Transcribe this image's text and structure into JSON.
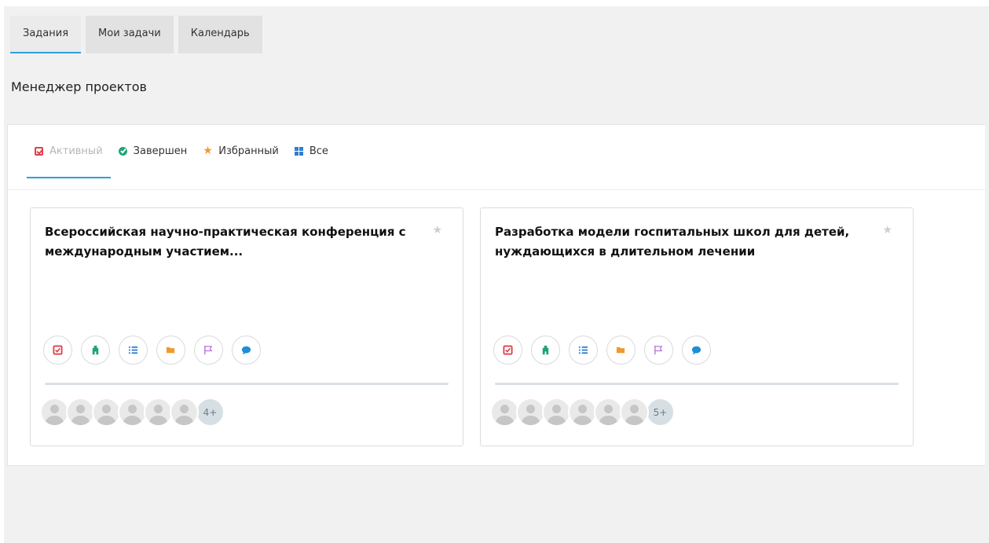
{
  "top_tabs": [
    {
      "label": "Задания",
      "active": true
    },
    {
      "label": "Мои задачи",
      "active": false
    },
    {
      "label": "Календарь",
      "active": false
    }
  ],
  "page_title": "Менеджер проектов",
  "filter_tabs": [
    {
      "label": "Активный",
      "icon": "todo-check-icon",
      "active": true
    },
    {
      "label": "Завершен",
      "icon": "check-circle-icon",
      "active": false
    },
    {
      "label": "Избранный",
      "icon": "star-icon",
      "active": false
    },
    {
      "label": "Все",
      "icon": "grid-icon",
      "active": false
    }
  ],
  "projects": [
    {
      "title": "Всероссийская научно-практическая конференция с международным участием...",
      "members_more": "4+"
    },
    {
      "title": "Разработка модели госпитальных школ для детей, нуждающихся в длительном лечении",
      "members_more": "5+"
    }
  ],
  "action_icons": [
    "task-list-icon",
    "milestone-icon",
    "list-icon",
    "files-folder-icon",
    "flag-icon",
    "discussion-icon"
  ],
  "colors": {
    "accent": "#2fa0d4",
    "task": "#e0404c",
    "milestone": "#1ea37a",
    "list": "#2f7fd0",
    "files": "#f09a2e",
    "flag": "#b06ad6",
    "discussion": "#1f8ed6"
  }
}
